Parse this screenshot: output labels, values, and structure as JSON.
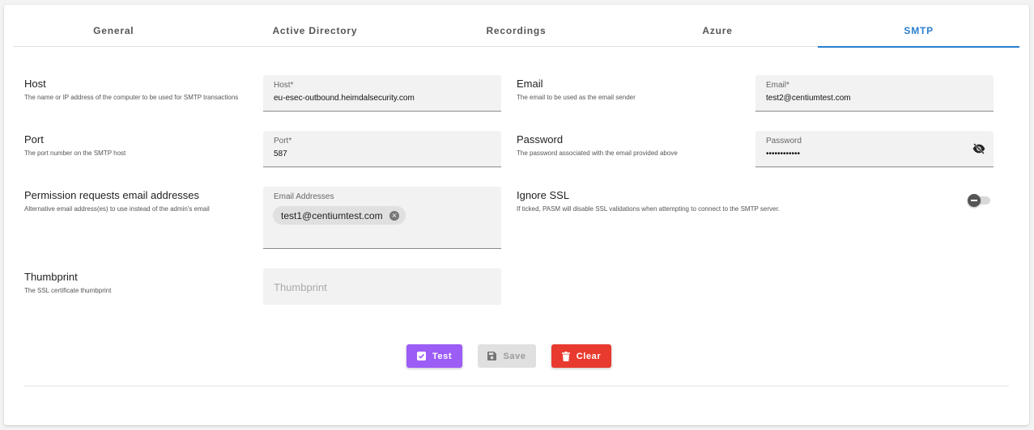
{
  "tabs": [
    {
      "label": "General"
    },
    {
      "label": "Active Directory"
    },
    {
      "label": "Recordings"
    },
    {
      "label": "Azure"
    },
    {
      "label": "SMTP",
      "active": true
    }
  ],
  "host": {
    "title": "Host",
    "description": "The name or IP address of the computer to be used for SMTP transactions",
    "field_label": "Host*",
    "value": "eu-esec-outbound.heimdalsecurity.com"
  },
  "email": {
    "title": "Email",
    "description": "The email to be used as the email sender",
    "field_label": "Email*",
    "value": "test2@centiumtest.com"
  },
  "port": {
    "title": "Port",
    "description": "The port number on the SMTP host",
    "field_label": "Port*",
    "value": "587"
  },
  "password": {
    "title": "Password",
    "description": "The password associated with the email provided above",
    "field_label": "Password",
    "value": "••••••••••••",
    "icon": "eye-off-icon"
  },
  "permission": {
    "title": "Permission requests email addresses",
    "description": "Alternative email address(es) to use instead of the admin's email",
    "field_label": "Email Addresses",
    "chips": [
      "test1@centiumtest.com"
    ]
  },
  "ignore_ssl": {
    "title": "Ignore SSL",
    "description": "If ticked, PASM will disable SSL validations when attempting to connect to the SMTP server.",
    "enabled": false
  },
  "thumbprint": {
    "title": "Thumbprint",
    "description": "The SSL certificate thumbprint",
    "placeholder": "Thumbprint"
  },
  "buttons": {
    "test": "Test",
    "save": "Save",
    "clear": "Clear"
  },
  "colors": {
    "accent": "#2a7fd0",
    "test_button": "#9c5cf6",
    "clear_button": "#e93a2f",
    "save_button_disabled": "#e0e0e0"
  }
}
